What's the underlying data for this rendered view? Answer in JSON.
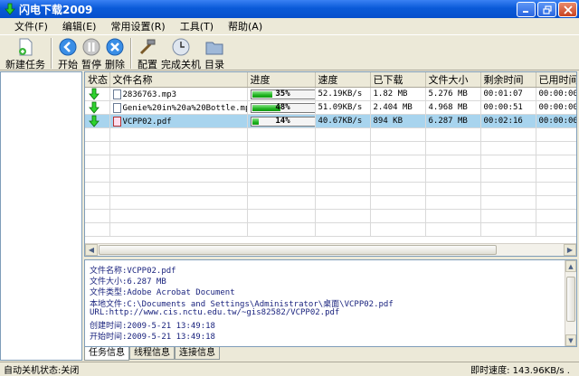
{
  "window": {
    "title": "闪电下载2009",
    "buttons": [
      "minimize",
      "restore",
      "close"
    ]
  },
  "menu": [
    {
      "label": "文件(F)"
    },
    {
      "label": "编辑(E)"
    },
    {
      "label": "常用设置(R)"
    },
    {
      "label": "工具(T)"
    },
    {
      "label": "帮助(A)"
    }
  ],
  "toolbar": {
    "new_task": "新建任务",
    "start": "开始",
    "pause": "暂停",
    "delete": "删除",
    "config": "配置",
    "shutdown_on_complete": "完成关机",
    "directory": "目录"
  },
  "table": {
    "columns": [
      "状态",
      "文件名称",
      "进度",
      "速度",
      "已下载",
      "文件大小",
      "剩余时间",
      "已用时间"
    ],
    "rows": [
      {
        "name": "2836763.mp3",
        "progress": 35,
        "progress_label": "35%",
        "speed": "52.19KB/s",
        "downloaded": "1.82 MB",
        "size": "5.276 MB",
        "remaining": "00:01:07",
        "elapsed": "00:00:00"
      },
      {
        "name": "Genie%20in%20a%20Bottle.mp3",
        "progress": 48,
        "progress_label": "48%",
        "speed": "51.09KB/s",
        "downloaded": "2.404 MB",
        "size": "4.968 MB",
        "remaining": "00:00:51",
        "elapsed": "00:00:00"
      },
      {
        "name": "VCPP02.pdf",
        "progress": 14,
        "progress_label": "14%",
        "speed": "40.67KB/s",
        "downloaded": "894 KB",
        "size": "6.287 MB",
        "remaining": "00:02:16",
        "elapsed": "00:00:00"
      }
    ]
  },
  "info": {
    "lines": [
      "文件名称:VCPP02.pdf",
      "文件大小:6.287 MB",
      "文件类型:Adobe Acrobat Document",
      "本地文件:C:\\Documents and Settings\\Administrator\\桌面\\VCPP02.pdf",
      "URL:http://www.cis.nctu.edu.tw/~gis82582/VCPP02.pdf",
      "创建时间:2009-5-21 13:49:18",
      "开始时间:2009-5-21 13:49:18"
    ]
  },
  "tabs": [
    "任务信息",
    "线程信息",
    "连接信息"
  ],
  "status": {
    "left": "自动关机状态:关闭",
    "right": "即时速度: 143.96KB/s ."
  },
  "colors": {
    "titlebar": "#0a5ad8",
    "selected_row": "#a8d4ee",
    "progress_fill": "#21b421",
    "info_text": "#1a237e"
  }
}
